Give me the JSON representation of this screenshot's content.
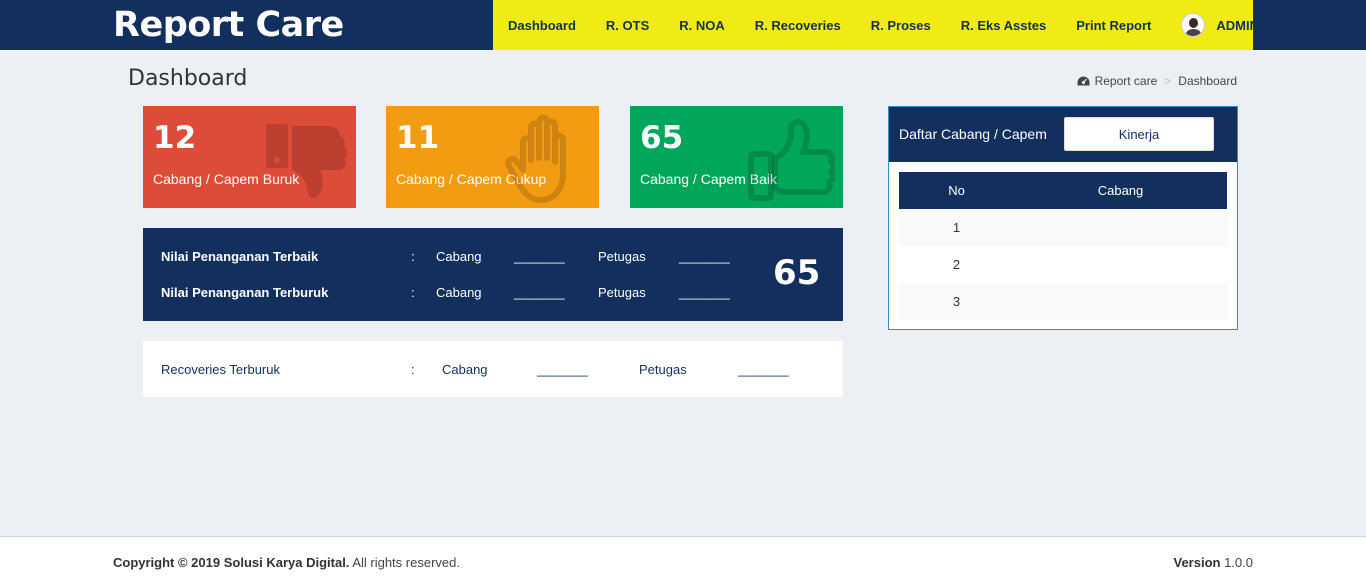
{
  "app": {
    "brand": "Report Care",
    "user_name": "ADMIN"
  },
  "nav": {
    "items": [
      "Dashboard",
      "R. OTS",
      "R. NOA",
      "R. Recoveries",
      "R. Proses",
      "R. Eks Asstes",
      "Print Report"
    ]
  },
  "page": {
    "title": "Dashboard",
    "breadcrumb": [
      "Report care",
      "Dashboard"
    ]
  },
  "stats": [
    {
      "value": "12",
      "label": "Cabang / Capem Buruk",
      "color": "#dd4b39",
      "icon": "thumbs-down-icon"
    },
    {
      "value": "11",
      "label": "Cabang / Capem Cukup",
      "color": "#f39c12",
      "icon": "hand-stop-icon"
    },
    {
      "value": "65",
      "label": "Cabang / Capem Baik",
      "color": "#00a65a",
      "icon": "thumbs-up-icon"
    }
  ],
  "nilai": {
    "rows": [
      {
        "label": "Nilai Penanganan Terbaik",
        "colon": ":",
        "cabang_key": "Cabang",
        "cabang_val": "_______",
        "petugas_key": "Petugas",
        "petugas_val": "_______"
      },
      {
        "label": "Nilai Penanganan Terburuk",
        "colon": ":",
        "cabang_key": "Cabang",
        "cabang_val": "_______",
        "petugas_key": "Petugas",
        "petugas_val": "_______"
      }
    ],
    "score": "65"
  },
  "recoveries": {
    "label": "Recoveries Terburuk",
    "colon": ":",
    "cabang_key": "Cabang",
    "cabang_val": "_______",
    "petugas_key": "Petugas",
    "petugas_val": "_______"
  },
  "branch_card": {
    "title": "Daftar Cabang / Capem",
    "button": "Kinerja",
    "columns": [
      "No",
      "Cabang"
    ],
    "rows": [
      {
        "no": "1",
        "cabang": ""
      },
      {
        "no": "2",
        "cabang": ""
      },
      {
        "no": "3",
        "cabang": ""
      }
    ]
  },
  "footer": {
    "copyright_bold": "Copyright © 2019 Solusi Karya Digital.",
    "copyright_rest": " All rights reserved.",
    "version_label": "Version",
    "version_value": " 1.0.0"
  },
  "colors": {
    "navy": "#132f5e",
    "menu_yellow": "#f0ec13",
    "red": "#dd4b39",
    "orange": "#f39c12",
    "green": "#00a65a"
  }
}
